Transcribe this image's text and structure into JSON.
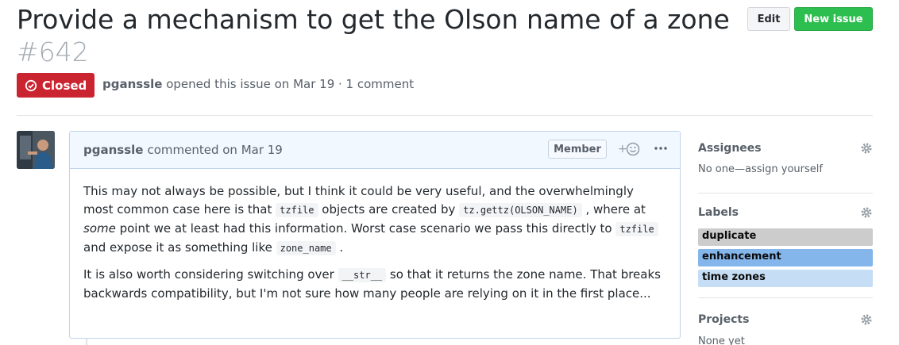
{
  "issue": {
    "title": "Provide a mechanism to get the Olson name of a zone",
    "number": "#642",
    "state": "Closed",
    "author": "pganssle",
    "meta_text": "opened this issue on Mar 19 · 1 comment"
  },
  "header_buttons": {
    "edit": "Edit",
    "new_issue": "New issue"
  },
  "comment": {
    "author": "pganssle",
    "action": "commented on Mar 19",
    "role_badge": "Member",
    "reaction_icon": "smiley-add-icon",
    "more_icon": "kebab-horizontal-icon",
    "p1": {
      "t1": "This may not always be possible, but I think it could be very useful, and the overwhelmingly most common case here is that ",
      "code1": "tzfile",
      "t2": " objects are created by ",
      "code2": "tz.gettz(OLSON_NAME)",
      "t3": " , where at ",
      "em": "some",
      "t4": " point we at least had this information. Worst case scenario we pass this directly to ",
      "code3": "tzfile",
      "t5": " and expose it as something like ",
      "code4": "zone_name",
      "t6": " ."
    },
    "p2": {
      "t1": "It is also worth considering switching over ",
      "code1": "__str__",
      "t2": " so that it returns the zone name. That breaks backwards compatibility, but I'm not sure how many people are relying on it in the first place..."
    }
  },
  "sidebar": {
    "assignees": {
      "heading": "Assignees",
      "text": "No one—assign yourself"
    },
    "labels": {
      "heading": "Labels",
      "items": [
        {
          "name": "duplicate",
          "color": "#cccccc"
        },
        {
          "name": "enhancement",
          "color": "#84b6eb"
        },
        {
          "name": "time zones",
          "color": "#c5def5"
        }
      ]
    },
    "projects": {
      "heading": "Projects",
      "text": "None yet"
    }
  },
  "colors": {
    "closed": "#cb2431",
    "new_issue": "#2cbe4e",
    "comment_header": "#f1f8ff"
  }
}
